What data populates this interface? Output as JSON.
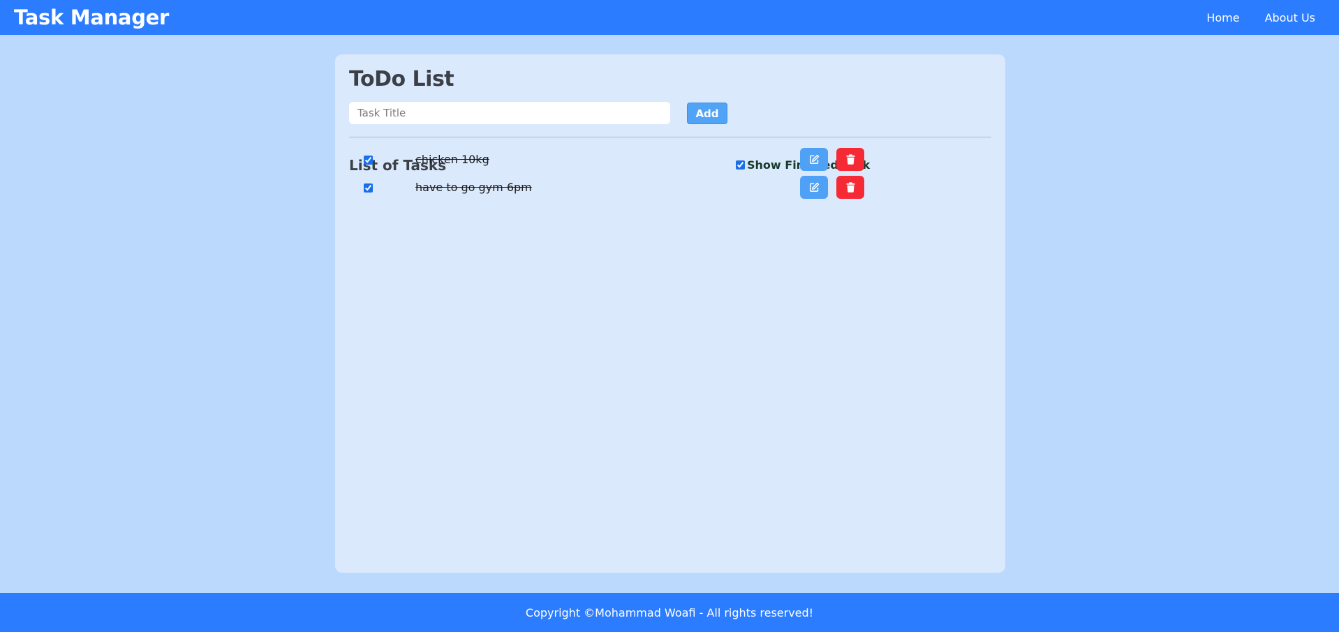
{
  "header": {
    "brand": "Task Manager",
    "nav": [
      {
        "label": "Home"
      },
      {
        "label": "About Us"
      }
    ]
  },
  "todo": {
    "title": "ToDo List",
    "input": {
      "placeholder": "Task Title",
      "value": ""
    },
    "add_label": "Add",
    "list_title": "List of Tasks",
    "show_finished_label": "Show Finished Task",
    "show_finished_checked": true,
    "tasks": [
      {
        "title": "chicken 10kg",
        "finished": true,
        "edit_icon": "edit-icon",
        "delete_icon": "trash-icon"
      },
      {
        "title": "have to go gym 6pm",
        "finished": true,
        "edit_icon": "edit-icon",
        "delete_icon": "trash-icon"
      }
    ]
  },
  "footer": {
    "text": "Copyright ©Mohammad Woafi - All rights reserved!"
  },
  "colors": {
    "primary": "#2b7cfe",
    "background": "#bbd9fd",
    "card": "#dbe9fd",
    "edit": "#4ea1f5",
    "delete": "#f62a35"
  }
}
